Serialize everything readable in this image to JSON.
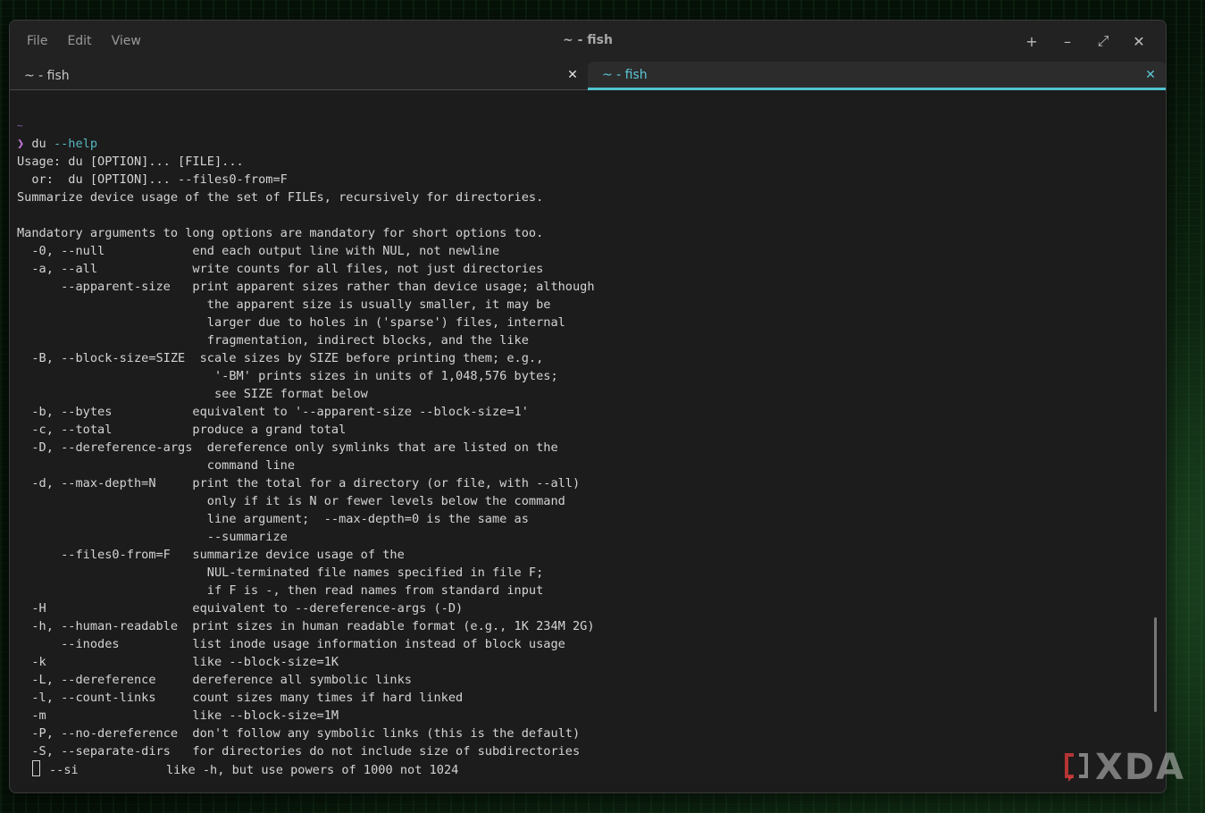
{
  "window": {
    "title": "~ - fish",
    "menu": [
      "File",
      "Edit",
      "View"
    ],
    "controls": {
      "new_tab": "+",
      "minimize": "–",
      "maximize": "⤢",
      "close": "✕"
    }
  },
  "tabs": [
    {
      "label": "~ - fish",
      "active": false,
      "close": "✕"
    },
    {
      "label": "~ - fish",
      "active": true,
      "close": "✕"
    }
  ],
  "terminal": {
    "cwd": "~",
    "prompt_symbol": "❯",
    "command": "du",
    "command_arg": "--help",
    "output": [
      "Usage: du [OPTION]... [FILE]...",
      "  or:  du [OPTION]... --files0-from=F",
      "Summarize device usage of the set of FILEs, recursively for directories.",
      "",
      "Mandatory arguments to long options are mandatory for short options too.",
      "  -0, --null            end each output line with NUL, not newline",
      "  -a, --all             write counts for all files, not just directories",
      "      --apparent-size   print apparent sizes rather than device usage; although",
      "                          the apparent size is usually smaller, it may be",
      "                          larger due to holes in ('sparse') files, internal",
      "                          fragmentation, indirect blocks, and the like",
      "  -B, --block-size=SIZE  scale sizes by SIZE before printing them; e.g.,",
      "                           '-BM' prints sizes in units of 1,048,576 bytes;",
      "                           see SIZE format below",
      "  -b, --bytes           equivalent to '--apparent-size --block-size=1'",
      "  -c, --total           produce a grand total",
      "  -D, --dereference-args  dereference only symlinks that are listed on the",
      "                          command line",
      "  -d, --max-depth=N     print the total for a directory (or file, with --all)",
      "                          only if it is N or fewer levels below the command",
      "                          line argument;  --max-depth=0 is the same as",
      "                          --summarize",
      "      --files0-from=F   summarize device usage of the",
      "                          NUL-terminated file names specified in file F;",
      "                          if F is -, then read names from standard input",
      "  -H                    equivalent to --dereference-args (-D)",
      "  -h, --human-readable  print sizes in human readable format (e.g., 1K 234M 2G)",
      "      --inodes          list inode usage information instead of block usage",
      "  -k                    like --block-size=1K",
      "  -L, --dereference     dereference all symbolic links",
      "  -l, --count-links     count sizes many times if hard linked",
      "  -m                    like --block-size=1M",
      "  -P, --no-dereference  don't follow any symbolic links (this is the default)",
      "  -S, --separate-dirs   for directories do not include size of subdirectories"
    ],
    "last_line": "--si            like -h, but use powers of 1000 not 1024"
  },
  "watermark": {
    "text": "XDA",
    "color": "#c8c8c8"
  },
  "colors": {
    "accent": "#4fc3cf",
    "prompt": "#c678dd",
    "background": "#1c1c1c"
  }
}
